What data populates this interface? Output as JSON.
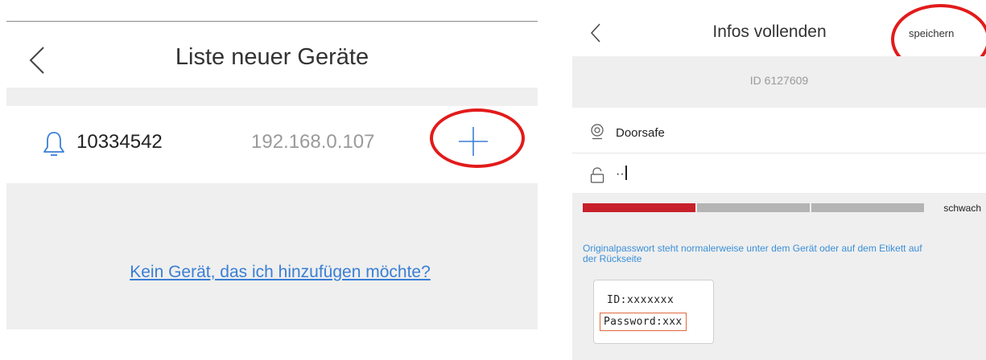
{
  "left_screen": {
    "title": "Liste neuer Geräte",
    "back_icon": "chevron-left-icon",
    "device": {
      "icon": "bell-icon",
      "id": "10334542",
      "ip": "192.168.0.107",
      "add_icon": "plus-icon"
    },
    "no_device_link": "Kein Gerät, das ich hinzufügen möchte?"
  },
  "right_screen": {
    "title": "Infos vollenden",
    "back_icon": "chevron-left-icon",
    "save_label": "speichern",
    "device_id": "ID 6127609",
    "name_field": {
      "icon": "location-pin-icon",
      "value": "Doorsafe"
    },
    "password_field": {
      "icon": "lock-icon",
      "value": "··"
    },
    "strength_label": "schwach",
    "strength_level_fraction": 0.33,
    "hint": "Originalpasswort steht normalerweise unter dem Gerät oder auf dem Etikett auf der Rückseite",
    "label_card": {
      "id_line": "ID:xxxxxxx",
      "password_line": "Password:xxx"
    }
  },
  "colors": {
    "accent_blue": "#3a7fd5",
    "highlight_red": "#e21b1b",
    "strength_red": "#c8202a",
    "background_gray": "#efefef"
  }
}
